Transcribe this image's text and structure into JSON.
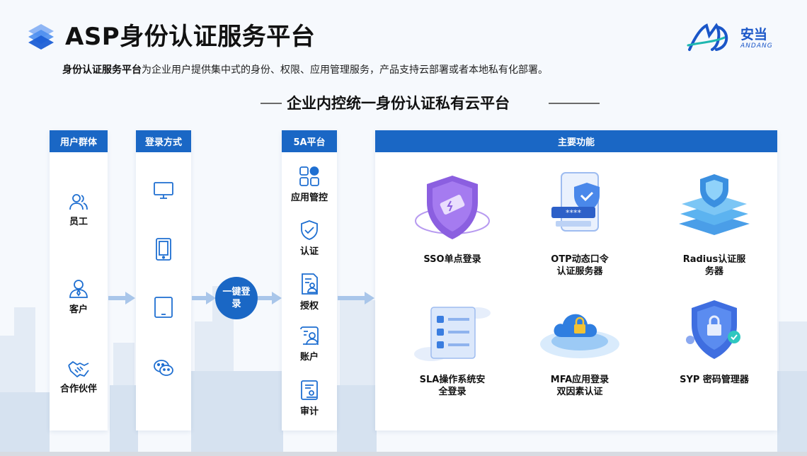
{
  "header": {
    "title": "ASP身份认证服务平台",
    "brand_name": "安当",
    "brand_sub": "ANDANG"
  },
  "intro": {
    "bold": "身份认证服务平台",
    "rest": "为企业用户提供集中式的身份、权限、应用管理服务，产品支持云部署或者本地私有化部署。"
  },
  "subtitle": "企业内控统一身份认证私有云平台",
  "users": {
    "title": "用户群体",
    "items": [
      {
        "label": "员工",
        "icon": "employees-icon"
      },
      {
        "label": "客户",
        "icon": "customer-icon"
      },
      {
        "label": "合作伙伴",
        "icon": "handshake-icon"
      }
    ]
  },
  "login": {
    "title": "登录方式",
    "items": [
      {
        "icon": "monitor-icon"
      },
      {
        "icon": "phone-icon"
      },
      {
        "icon": "tablet-icon"
      },
      {
        "icon": "wechat-icon"
      }
    ]
  },
  "one_key": "一键登录",
  "platform": {
    "title": "5A平台",
    "items": [
      {
        "label": "应用管控",
        "icon": "apps-icon"
      },
      {
        "label": "认证",
        "icon": "shield-check-icon"
      },
      {
        "label": "授权",
        "icon": "document-user-icon"
      },
      {
        "label": "账户",
        "icon": "account-icon"
      },
      {
        "label": "审计",
        "icon": "audit-icon"
      }
    ]
  },
  "main": {
    "title": "主要功能",
    "features": [
      {
        "line1": "SSO单点登录",
        "line2": ""
      },
      {
        "line1": "OTP动态口令",
        "line2": "认证服务器"
      },
      {
        "line1": "Radius认证服",
        "line2": "务器"
      },
      {
        "line1": "SLA操作系统安",
        "line2": "全登录"
      },
      {
        "line1": "MFA应用登录",
        "line2": "双因素认证"
      },
      {
        "line1": "SYP 密码管理器",
        "line2": ""
      }
    ]
  },
  "colors": {
    "primary": "#1a67c5",
    "arrow": "#a9c6ea",
    "icon": "#1f6fd1"
  }
}
